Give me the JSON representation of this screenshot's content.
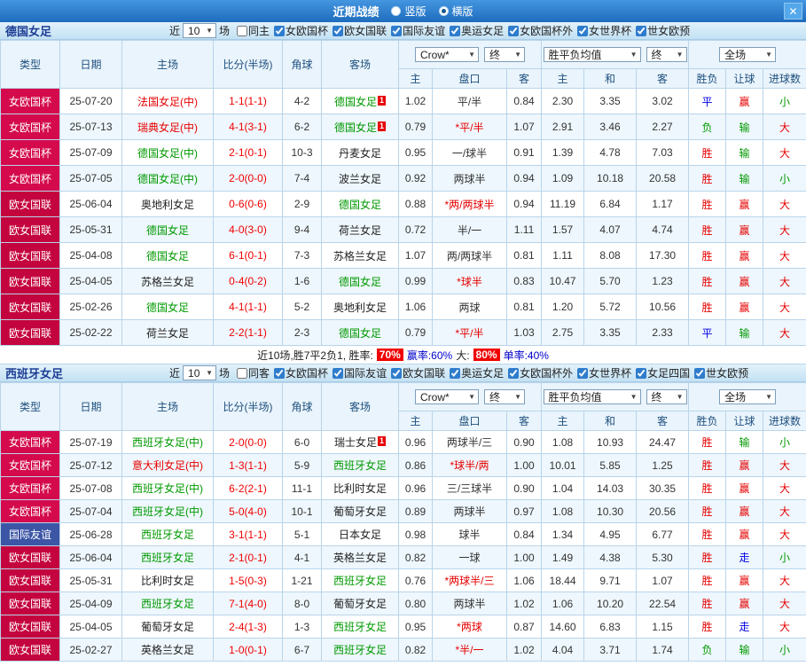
{
  "titlebar": {
    "title": "近期战绩",
    "vertical": "竖版",
    "horizontal": "横版",
    "selected_layout": "横版"
  },
  "icons": {
    "chevron_down": "▼",
    "close": "✕"
  },
  "labels": {
    "near": "近",
    "games": "场",
    "columns": {
      "type": "类型",
      "date": "日期",
      "home": "主场",
      "score": "比分(半场)",
      "corner": "角球",
      "away": "客场",
      "h": "主",
      "handicap": "盘口",
      "a": "客",
      "avg_h": "主",
      "avg_d": "和",
      "avg_a": "客",
      "wdl": "胜负",
      "let": "让球",
      "goals": "进球数"
    },
    "selects": {
      "company": "Crow*",
      "final": "终",
      "avg": "胜平负均值",
      "full": "全场"
    }
  },
  "sections": [
    {
      "team": "德国女足",
      "filters": {
        "count": "10",
        "same_label": "同主",
        "same_checked": false,
        "comps": [
          "女欧国杯",
          "欧女国联",
          "国际友谊",
          "奥运女足",
          "女欧国杯外",
          "女世界杯",
          "世女欧预"
        ]
      },
      "rows": [
        {
          "type": "女欧国杯",
          "type_cls": "cup",
          "date": "25-07-20",
          "home": "法国女足(中)",
          "home_cls": "red",
          "score": "1-1(1-1)",
          "corner": "4-2",
          "away": "德国女足",
          "away_cls": "green",
          "away_sup": "1",
          "odds_h": "1.02",
          "handicap": "平/半",
          "handicap_red": false,
          "odds_a": "0.84",
          "avg_h": "2.30",
          "avg_d": "3.35",
          "avg_a": "3.02",
          "res_wdl": "平",
          "res_wdl_cls": "blue",
          "res_let": "赢",
          "res_let_cls": "red",
          "res_goal": "小",
          "res_goal_cls": "green"
        },
        {
          "type": "女欧国杯",
          "type_cls": "cup",
          "date": "25-07-13",
          "home": "瑞典女足(中)",
          "home_cls": "red",
          "score": "4-1(3-1)",
          "corner": "6-2",
          "away": "德国女足",
          "away_cls": "green",
          "away_sup": "1",
          "odds_h": "0.79",
          "handicap": "*平/半",
          "handicap_red": true,
          "odds_a": "1.07",
          "avg_h": "2.91",
          "avg_d": "3.46",
          "avg_a": "2.27",
          "res_wdl": "负",
          "res_wdl_cls": "green",
          "res_let": "输",
          "res_let_cls": "green",
          "res_goal": "大",
          "res_goal_cls": "red"
        },
        {
          "type": "女欧国杯",
          "type_cls": "cup",
          "date": "25-07-09",
          "home": "德国女足(中)",
          "home_cls": "green",
          "score": "2-1(0-1)",
          "corner": "10-3",
          "away": "丹麦女足",
          "away_cls": "black",
          "odds_h": "0.95",
          "handicap": "一/球半",
          "handicap_red": false,
          "odds_a": "0.91",
          "avg_h": "1.39",
          "avg_d": "4.78",
          "avg_a": "7.03",
          "res_wdl": "胜",
          "res_wdl_cls": "red",
          "res_let": "输",
          "res_let_cls": "green",
          "res_goal": "大",
          "res_goal_cls": "red"
        },
        {
          "type": "女欧国杯",
          "type_cls": "cup",
          "date": "25-07-05",
          "home": "德国女足(中)",
          "home_cls": "green",
          "score": "2-0(0-0)",
          "corner": "7-4",
          "away": "波兰女足",
          "away_cls": "black",
          "odds_h": "0.92",
          "handicap": "两球半",
          "handicap_red": false,
          "odds_a": "0.94",
          "avg_h": "1.09",
          "avg_d": "10.18",
          "avg_a": "20.58",
          "res_wdl": "胜",
          "res_wdl_cls": "red",
          "res_let": "输",
          "res_let_cls": "green",
          "res_goal": "小",
          "res_goal_cls": "green"
        },
        {
          "type": "欧女国联",
          "type_cls": "league",
          "date": "25-06-04",
          "home": "奥地利女足",
          "home_cls": "black",
          "score": "0-6(0-6)",
          "corner": "2-9",
          "away": "德国女足",
          "away_cls": "green",
          "odds_h": "0.88",
          "handicap": "*两/两球半",
          "handicap_red": true,
          "odds_a": "0.94",
          "avg_h": "11.19",
          "avg_d": "6.84",
          "avg_a": "1.17",
          "res_wdl": "胜",
          "res_wdl_cls": "red",
          "res_let": "赢",
          "res_let_cls": "red",
          "res_goal": "大",
          "res_goal_cls": "red"
        },
        {
          "type": "欧女国联",
          "type_cls": "league",
          "date": "25-05-31",
          "home": "德国女足",
          "home_cls": "green",
          "score": "4-0(3-0)",
          "corner": "9-4",
          "away": "荷兰女足",
          "away_cls": "black",
          "odds_h": "0.72",
          "handicap": "半/一",
          "handicap_red": false,
          "odds_a": "1.11",
          "avg_h": "1.57",
          "avg_d": "4.07",
          "avg_a": "4.74",
          "res_wdl": "胜",
          "res_wdl_cls": "red",
          "res_let": "赢",
          "res_let_cls": "red",
          "res_goal": "大",
          "res_goal_cls": "red"
        },
        {
          "type": "欧女国联",
          "type_cls": "league",
          "date": "25-04-08",
          "home": "德国女足",
          "home_cls": "green",
          "score": "6-1(0-1)",
          "corner": "7-3",
          "away": "苏格兰女足",
          "away_cls": "black",
          "odds_h": "1.07",
          "handicap": "两/两球半",
          "handicap_red": false,
          "odds_a": "0.81",
          "avg_h": "1.11",
          "avg_d": "8.08",
          "avg_a": "17.30",
          "res_wdl": "胜",
          "res_wdl_cls": "red",
          "res_let": "赢",
          "res_let_cls": "red",
          "res_goal": "大",
          "res_goal_cls": "red"
        },
        {
          "type": "欧女国联",
          "type_cls": "league",
          "date": "25-04-05",
          "home": "苏格兰女足",
          "home_cls": "black",
          "score": "0-4(0-2)",
          "corner": "1-6",
          "away": "德国女足",
          "away_cls": "green",
          "odds_h": "0.99",
          "handicap": "*球半",
          "handicap_red": true,
          "odds_a": "0.83",
          "avg_h": "10.47",
          "avg_d": "5.70",
          "avg_a": "1.23",
          "res_wdl": "胜",
          "res_wdl_cls": "red",
          "res_let": "赢",
          "res_let_cls": "red",
          "res_goal": "大",
          "res_goal_cls": "red"
        },
        {
          "type": "欧女国联",
          "type_cls": "league",
          "date": "25-02-26",
          "home": "德国女足",
          "home_cls": "green",
          "score": "4-1(1-1)",
          "corner": "5-2",
          "away": "奥地利女足",
          "away_cls": "black",
          "odds_h": "1.06",
          "handicap": "两球",
          "handicap_red": false,
          "odds_a": "0.81",
          "avg_h": "1.20",
          "avg_d": "5.72",
          "avg_a": "10.56",
          "res_wdl": "胜",
          "res_wdl_cls": "red",
          "res_let": "赢",
          "res_let_cls": "red",
          "res_goal": "大",
          "res_goal_cls": "red"
        },
        {
          "type": "欧女国联",
          "type_cls": "league",
          "date": "25-02-22",
          "home": "荷兰女足",
          "home_cls": "black",
          "score": "2-2(1-1)",
          "corner": "2-3",
          "away": "德国女足",
          "away_cls": "green",
          "odds_h": "0.79",
          "handicap": "*平/半",
          "handicap_red": true,
          "odds_a": "1.03",
          "avg_h": "2.75",
          "avg_d": "3.35",
          "avg_a": "2.33",
          "res_wdl": "平",
          "res_wdl_cls": "blue",
          "res_let": "输",
          "res_let_cls": "green",
          "res_goal": "大",
          "res_goal_cls": "red"
        }
      ],
      "summary": {
        "text1": "近10场,胜7平2负1, 胜率:",
        "rate1": "70%",
        "text2": "赢率:60%",
        "text3": "大:",
        "rate2": "80%",
        "text4": "单率:40%"
      }
    },
    {
      "team": "西班牙女足",
      "filters": {
        "count": "10",
        "same_label": "同客",
        "same_checked": false,
        "comps": [
          "女欧国杯",
          "国际友谊",
          "欧女国联",
          "奥运女足",
          "女欧国杯外",
          "女世界杯",
          "女足四国",
          "世女欧预"
        ]
      },
      "rows": [
        {
          "type": "女欧国杯",
          "type_cls": "cup",
          "date": "25-07-19",
          "home": "西班牙女足(中)",
          "home_cls": "green",
          "score": "2-0(0-0)",
          "corner": "6-0",
          "away": "瑞士女足",
          "away_cls": "black",
          "away_sup": "1",
          "odds_h": "0.96",
          "handicap": "两球半/三",
          "handicap_red": false,
          "odds_a": "0.90",
          "avg_h": "1.08",
          "avg_d": "10.93",
          "avg_a": "24.47",
          "res_wdl": "胜",
          "res_wdl_cls": "red",
          "res_let": "输",
          "res_let_cls": "green",
          "res_goal": "小",
          "res_goal_cls": "green"
        },
        {
          "type": "女欧国杯",
          "type_cls": "cup",
          "date": "25-07-12",
          "home": "意大利女足(中)",
          "home_cls": "red",
          "score": "1-3(1-1)",
          "corner": "5-9",
          "away": "西班牙女足",
          "away_cls": "green",
          "odds_h": "0.86",
          "handicap": "*球半/两",
          "handicap_red": true,
          "odds_a": "1.00",
          "avg_h": "10.01",
          "avg_d": "5.85",
          "avg_a": "1.25",
          "res_wdl": "胜",
          "res_wdl_cls": "red",
          "res_let": "赢",
          "res_let_cls": "red",
          "res_goal": "大",
          "res_goal_cls": "red"
        },
        {
          "type": "女欧国杯",
          "type_cls": "cup",
          "date": "25-07-08",
          "home": "西班牙女足(中)",
          "home_cls": "green",
          "score": "6-2(2-1)",
          "corner": "11-1",
          "away": "比利时女足",
          "away_cls": "black",
          "odds_h": "0.96",
          "handicap": "三/三球半",
          "handicap_red": false,
          "odds_a": "0.90",
          "avg_h": "1.04",
          "avg_d": "14.03",
          "avg_a": "30.35",
          "res_wdl": "胜",
          "res_wdl_cls": "red",
          "res_let": "赢",
          "res_let_cls": "red",
          "res_goal": "大",
          "res_goal_cls": "red"
        },
        {
          "type": "女欧国杯",
          "type_cls": "cup",
          "date": "25-07-04",
          "home": "西班牙女足(中)",
          "home_cls": "green",
          "score": "5-0(4-0)",
          "corner": "10-1",
          "away": "葡萄牙女足",
          "away_cls": "black",
          "odds_h": "0.89",
          "handicap": "两球半",
          "handicap_red": false,
          "odds_a": "0.97",
          "avg_h": "1.08",
          "avg_d": "10.30",
          "avg_a": "20.56",
          "res_wdl": "胜",
          "res_wdl_cls": "red",
          "res_let": "赢",
          "res_let_cls": "red",
          "res_goal": "大",
          "res_goal_cls": "red"
        },
        {
          "type": "国际友谊",
          "type_cls": "friendly",
          "date": "25-06-28",
          "home": "西班牙女足",
          "home_cls": "green",
          "score": "3-1(1-1)",
          "corner": "5-1",
          "away": "日本女足",
          "away_cls": "black",
          "odds_h": "0.98",
          "handicap": "球半",
          "handicap_red": false,
          "odds_a": "0.84",
          "avg_h": "1.34",
          "avg_d": "4.95",
          "avg_a": "6.77",
          "res_wdl": "胜",
          "res_wdl_cls": "red",
          "res_let": "赢",
          "res_let_cls": "red",
          "res_goal": "大",
          "res_goal_cls": "red"
        },
        {
          "type": "欧女国联",
          "type_cls": "league",
          "date": "25-06-04",
          "home": "西班牙女足",
          "home_cls": "green",
          "score": "2-1(0-1)",
          "corner": "4-1",
          "away": "英格兰女足",
          "away_cls": "black",
          "odds_h": "0.82",
          "handicap": "一球",
          "handicap_red": false,
          "odds_a": "1.00",
          "avg_h": "1.49",
          "avg_d": "4.38",
          "avg_a": "5.30",
          "res_wdl": "胜",
          "res_wdl_cls": "red",
          "res_let": "走",
          "res_let_cls": "blue",
          "res_goal": "小",
          "res_goal_cls": "green"
        },
        {
          "type": "欧女国联",
          "type_cls": "league",
          "date": "25-05-31",
          "home": "比利时女足",
          "home_cls": "black",
          "score": "1-5(0-3)",
          "corner": "1-21",
          "away": "西班牙女足",
          "away_cls": "green",
          "odds_h": "0.76",
          "handicap": "*两球半/三",
          "handicap_red": true,
          "odds_a": "1.06",
          "avg_h": "18.44",
          "avg_d": "9.71",
          "avg_a": "1.07",
          "res_wdl": "胜",
          "res_wdl_cls": "red",
          "res_let": "赢",
          "res_let_cls": "red",
          "res_goal": "大",
          "res_goal_cls": "red"
        },
        {
          "type": "欧女国联",
          "type_cls": "league",
          "date": "25-04-09",
          "home": "西班牙女足",
          "home_cls": "green",
          "score": "7-1(4-0)",
          "corner": "8-0",
          "away": "葡萄牙女足",
          "away_cls": "black",
          "odds_h": "0.80",
          "handicap": "两球半",
          "handicap_red": false,
          "odds_a": "1.02",
          "avg_h": "1.06",
          "avg_d": "10.20",
          "avg_a": "22.54",
          "res_wdl": "胜",
          "res_wdl_cls": "red",
          "res_let": "赢",
          "res_let_cls": "red",
          "res_goal": "大",
          "res_goal_cls": "red"
        },
        {
          "type": "欧女国联",
          "type_cls": "league",
          "date": "25-04-05",
          "home": "葡萄牙女足",
          "home_cls": "black",
          "score": "2-4(1-3)",
          "corner": "1-3",
          "away": "西班牙女足",
          "away_cls": "green",
          "odds_h": "0.95",
          "handicap": "*两球",
          "handicap_red": true,
          "odds_a": "0.87",
          "avg_h": "14.60",
          "avg_d": "6.83",
          "avg_a": "1.15",
          "res_wdl": "胜",
          "res_wdl_cls": "red",
          "res_let": "走",
          "res_let_cls": "blue",
          "res_goal": "大",
          "res_goal_cls": "red"
        },
        {
          "type": "欧女国联",
          "type_cls": "league",
          "date": "25-02-27",
          "home": "英格兰女足",
          "home_cls": "black",
          "score": "1-0(0-1)",
          "corner": "6-7",
          "away": "西班牙女足",
          "away_cls": "green",
          "odds_h": "0.82",
          "handicap": "*半/一",
          "handicap_red": true,
          "odds_a": "1.02",
          "avg_h": "4.04",
          "avg_d": "3.71",
          "avg_a": "1.74",
          "res_wdl": "负",
          "res_wdl_cls": "green",
          "res_let": "输",
          "res_let_cls": "green",
          "res_goal": "小",
          "res_goal_cls": "green"
        }
      ]
    }
  ]
}
